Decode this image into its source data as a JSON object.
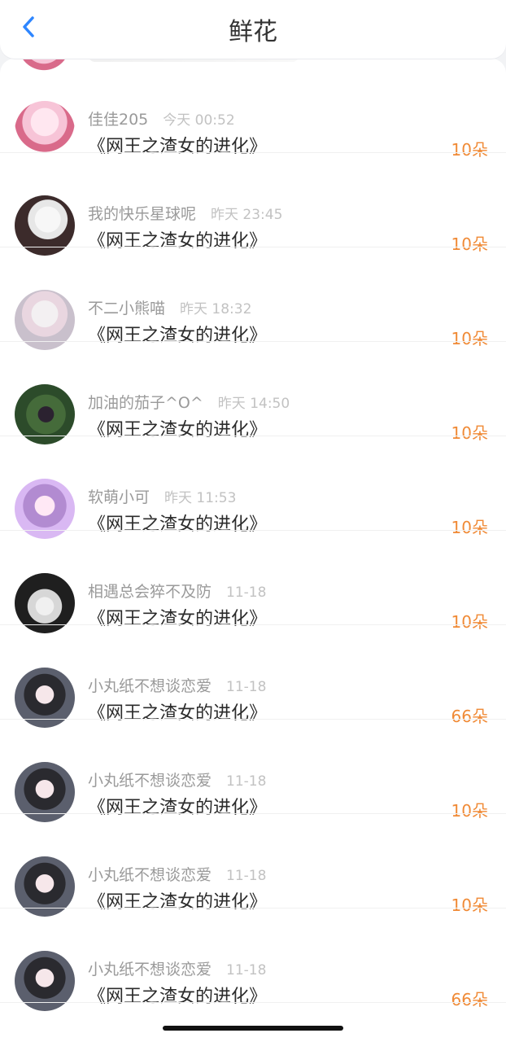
{
  "header": {
    "title": "鲜花"
  },
  "icons": {
    "back": "chevron-left-icon"
  },
  "rows": [
    {
      "name": "佳佳205",
      "time": "今天 00:52",
      "book": "《网王之渣女的进化》",
      "amount": "10朵",
      "avatar_style": "anime"
    },
    {
      "name": "我的快乐星球呢",
      "time": "昨天 23:45",
      "book": "《网王之渣女的进化》",
      "amount": "10朵",
      "avatar_style": "dog"
    },
    {
      "name": "不二小熊喵",
      "time": "昨天 18:32",
      "book": "《网王之渣女的进化》",
      "amount": "10朵",
      "avatar_style": "girl1"
    },
    {
      "name": "加油的茄子^O^",
      "time": "昨天 14:50",
      "book": "《网王之渣女的进化》",
      "amount": "10朵",
      "avatar_style": "eggplant"
    },
    {
      "name": "软萌小可",
      "time": "昨天 11:53",
      "book": "《网王之渣女的进化》",
      "amount": "10朵",
      "avatar_style": "purple"
    },
    {
      "name": "相遇总会猝不及防",
      "time": "11-18",
      "book": "《网王之渣女的进化》",
      "amount": "10朵",
      "avatar_style": "hand"
    },
    {
      "name": "小丸纸不想谈恋爱",
      "time": "11-18",
      "book": "《网王之渣女的进化》",
      "amount": "66朵",
      "avatar_style": "girl2"
    },
    {
      "name": "小丸纸不想谈恋爱",
      "time": "11-18",
      "book": "《网王之渣女的进化》",
      "amount": "10朵",
      "avatar_style": "girl2"
    },
    {
      "name": "小丸纸不想谈恋爱",
      "time": "11-18",
      "book": "《网王之渣女的进化》",
      "amount": "10朵",
      "avatar_style": "girl2"
    },
    {
      "name": "小丸纸不想谈恋爱",
      "time": "11-18",
      "book": "《网王之渣女的进化》",
      "amount": "66朵",
      "avatar_style": "girl2"
    }
  ],
  "colors": {
    "accent_orange": "#f08a36",
    "back_blue": "#2e86ff"
  }
}
